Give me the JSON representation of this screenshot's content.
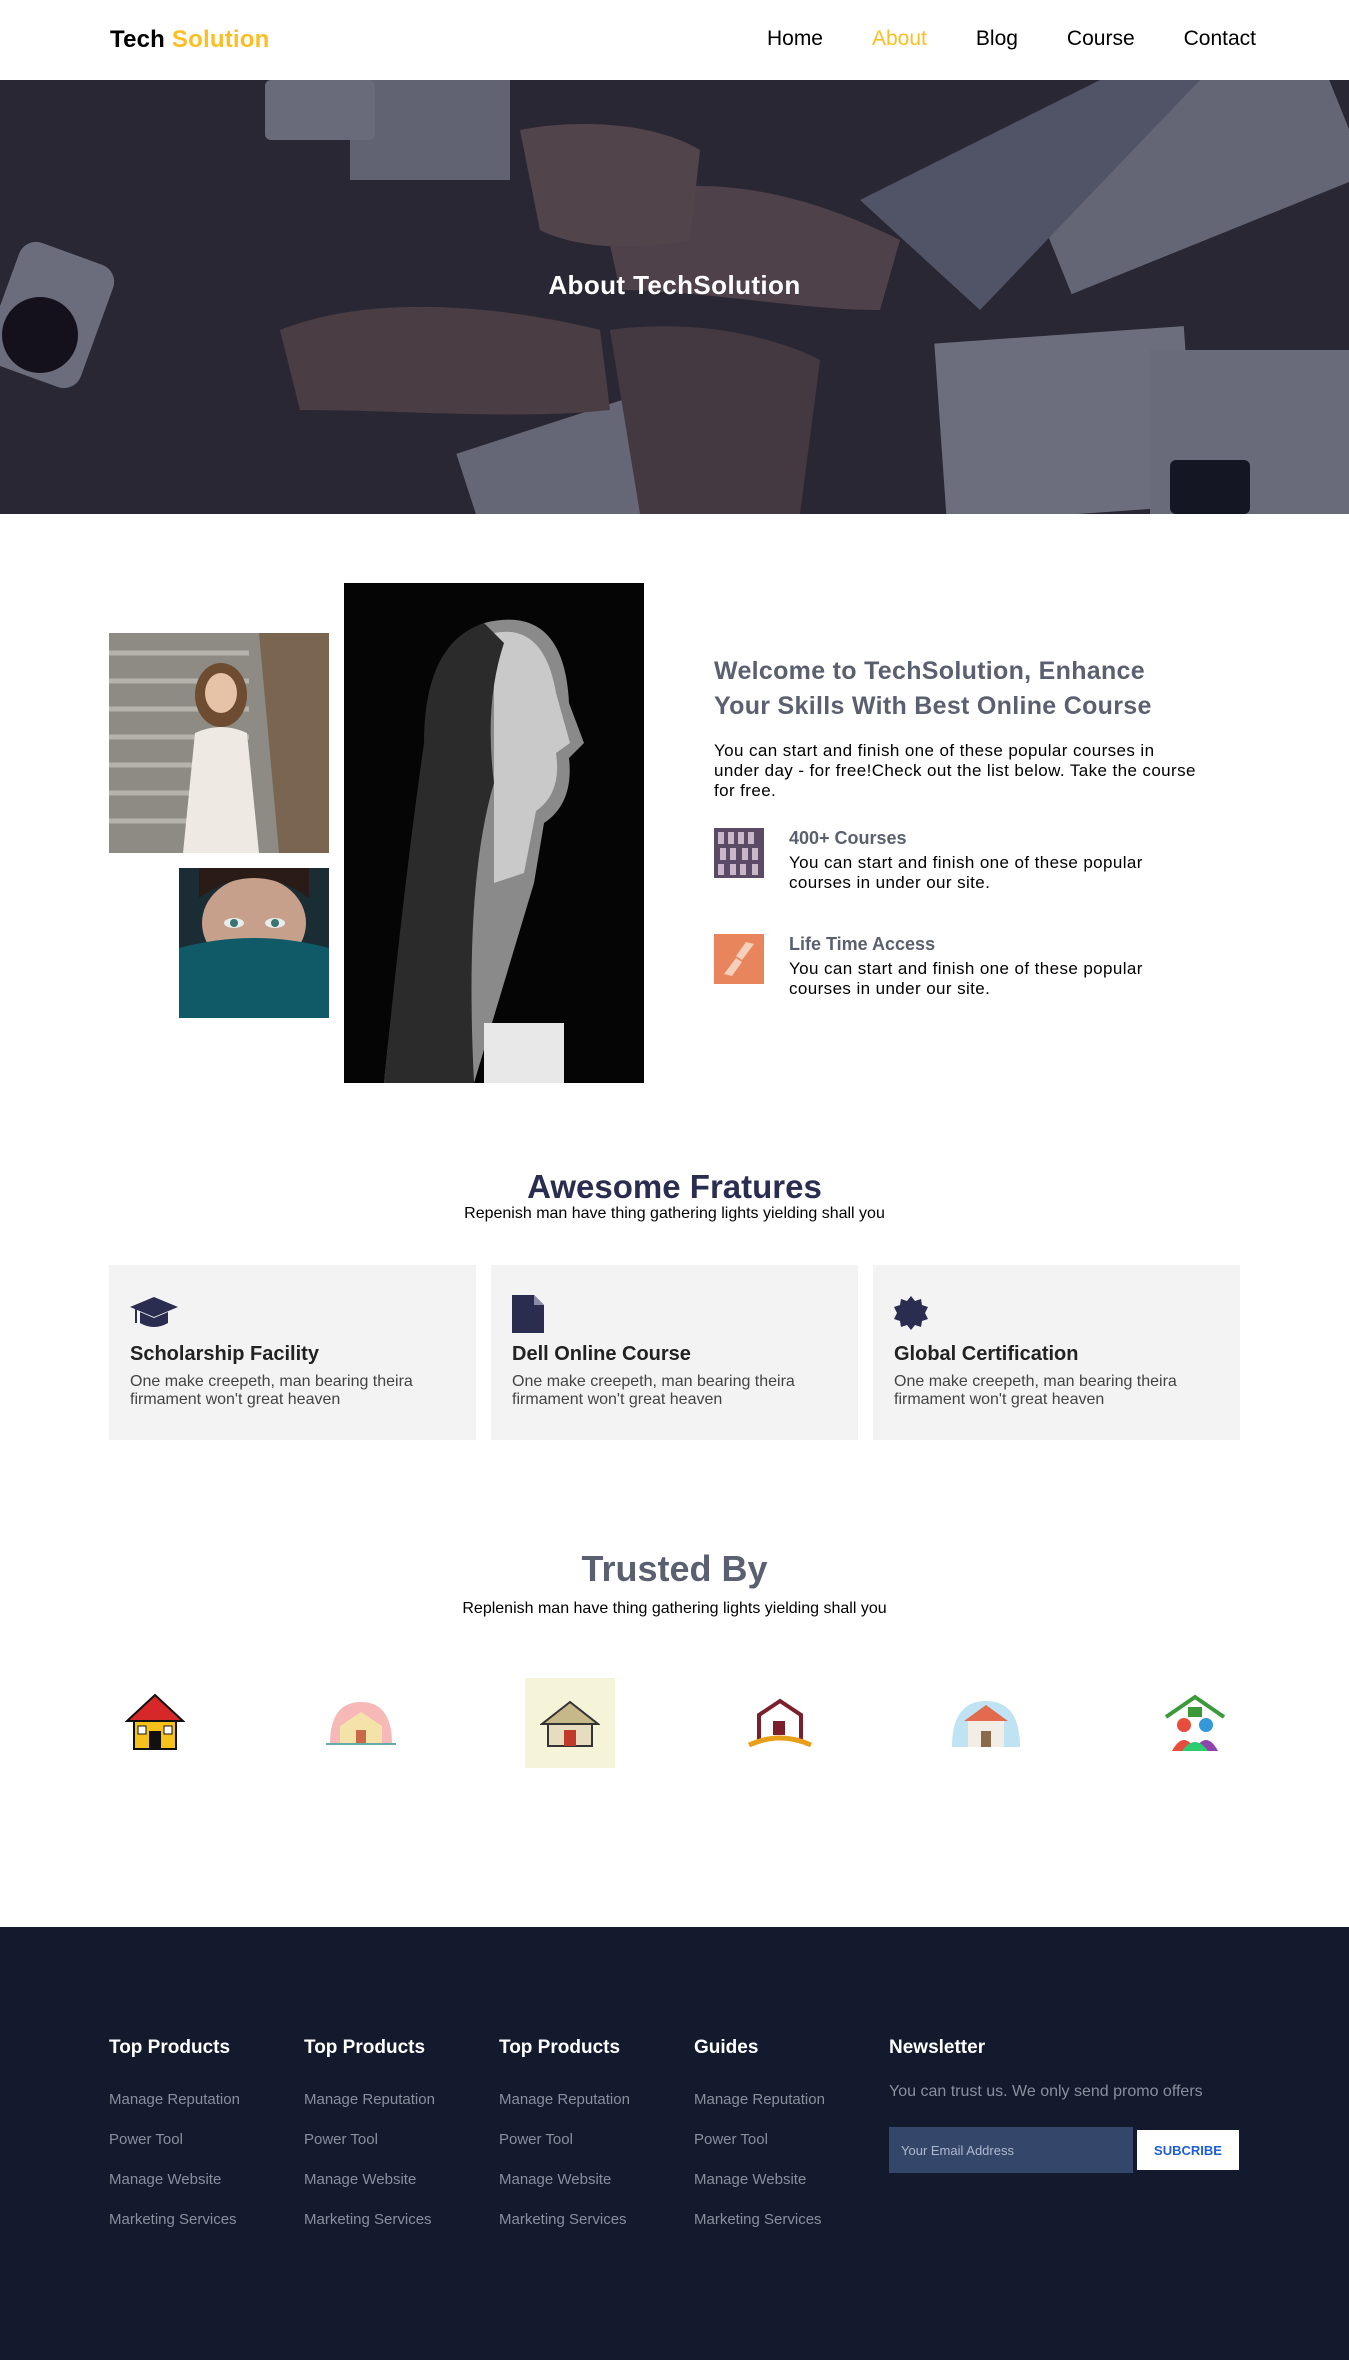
{
  "nav": {
    "brand_part1": "Tech",
    "brand_part2": "Solution",
    "items": [
      {
        "label": "Home",
        "active": false
      },
      {
        "label": "About",
        "active": true
      },
      {
        "label": "Blog",
        "active": false
      },
      {
        "label": "Course",
        "active": false
      },
      {
        "label": "Contact",
        "active": false
      }
    ]
  },
  "hero": {
    "title": "About TechSolution"
  },
  "about": {
    "title": "Welcome to TechSolution, Enhance Your Skills With Best Online Course",
    "description": "You can start and finish one of these popular courses in under day - for free!Check out the list below. Take the course for free.",
    "features": [
      {
        "icon": "books-icon",
        "title": "400+ Courses",
        "text": "You can start and finish one of these popular courses in under our site."
      },
      {
        "icon": "handshake-icon",
        "title": "Life Time Access",
        "text": "You can start and finish one of these popular courses in under our site."
      }
    ]
  },
  "features_section": {
    "title": "Awesome Fratures",
    "subtitle": "Repenish man have thing gathering lights yielding shall you",
    "cards": [
      {
        "icon": "graduation-cap-icon",
        "title": "Scholarship Facility",
        "text": "One make creepeth, man bearing theira firmament won't great heaven"
      },
      {
        "icon": "document-icon",
        "title": "Dell Online Course",
        "text": "One make creepeth, man bearing theira firmament won't great heaven"
      },
      {
        "icon": "certificate-icon",
        "title": "Global Certification",
        "text": "One make creepeth, man bearing theira firmament won't great heaven"
      }
    ]
  },
  "trusted": {
    "title": "Trusted By",
    "subtitle": "Replenish man have thing gathering lights yielding shall you",
    "logos": [
      "house-logo-1",
      "house-logo-2",
      "house-logo-3",
      "house-logo-4",
      "house-logo-5",
      "house-logo-6"
    ]
  },
  "footer": {
    "columns": [
      {
        "title": "Top Products",
        "links": [
          "Manage Reputation",
          "Power Tool",
          "Manage Website",
          "Marketing Services"
        ]
      },
      {
        "title": "Top Products",
        "links": [
          "Manage Reputation",
          "Power Tool",
          "Manage Website",
          "Marketing Services"
        ]
      },
      {
        "title": "Top Products",
        "links": [
          "Manage Reputation",
          "Power Tool",
          "Manage Website",
          "Marketing Services"
        ]
      },
      {
        "title": "Guides",
        "links": [
          "Manage Reputation",
          "Power Tool",
          "Manage Website",
          "Marketing Services"
        ]
      }
    ],
    "newsletter": {
      "title": "Newsletter",
      "text": "You can trust us. We only send promo offers",
      "placeholder": "Your Email Address",
      "button": "SUBCRIBE"
    }
  },
  "colors": {
    "accent": "#fbbf24",
    "heading": "#5b6070",
    "dark_navy": "#2a2d4f",
    "footer_bg": "#131a2e",
    "card_bg": "#f3f3f4"
  }
}
